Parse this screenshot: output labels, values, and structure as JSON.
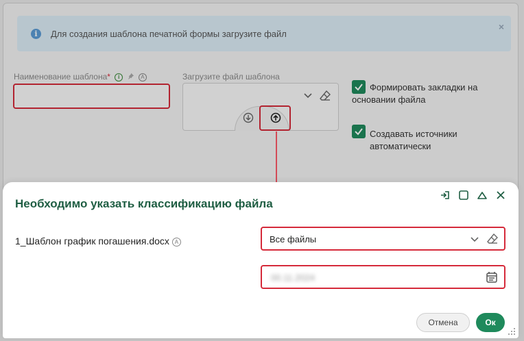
{
  "background": {
    "info_text": "Для создания шаблона печатной формы загрузите файл",
    "info_close": "×",
    "template_name_label": "Наименование шаблона",
    "required_mark": "*",
    "upload_label": "Загрузите файл шаблона",
    "checkbox1_line1": "Формировать закладки на",
    "checkbox1_line2": "основании файла",
    "checkbox2_line1": "Создавать источники",
    "checkbox2_line2": "автоматически"
  },
  "modal": {
    "title": "Необходимо указать классификацию файла",
    "file_name": "1_Шаблон график погашения.docx",
    "select_value": "Все файлы",
    "date_value": "00.11.2024",
    "cancel_label": "Отмена",
    "ok_label": "Ок"
  },
  "colors": {
    "accent_green": "#1f8a5c",
    "title_green": "#1f5e43",
    "highlight_red": "#d52a3a"
  },
  "icons": [
    "info-icon",
    "close-icon",
    "pin-icon",
    "chevron-down-icon",
    "eraser-icon",
    "download-icon",
    "upload-icon",
    "checkbox-checked-icon",
    "restore-icon",
    "square-icon",
    "collapse-icon",
    "calendar-icon",
    "resize-grip-icon"
  ]
}
